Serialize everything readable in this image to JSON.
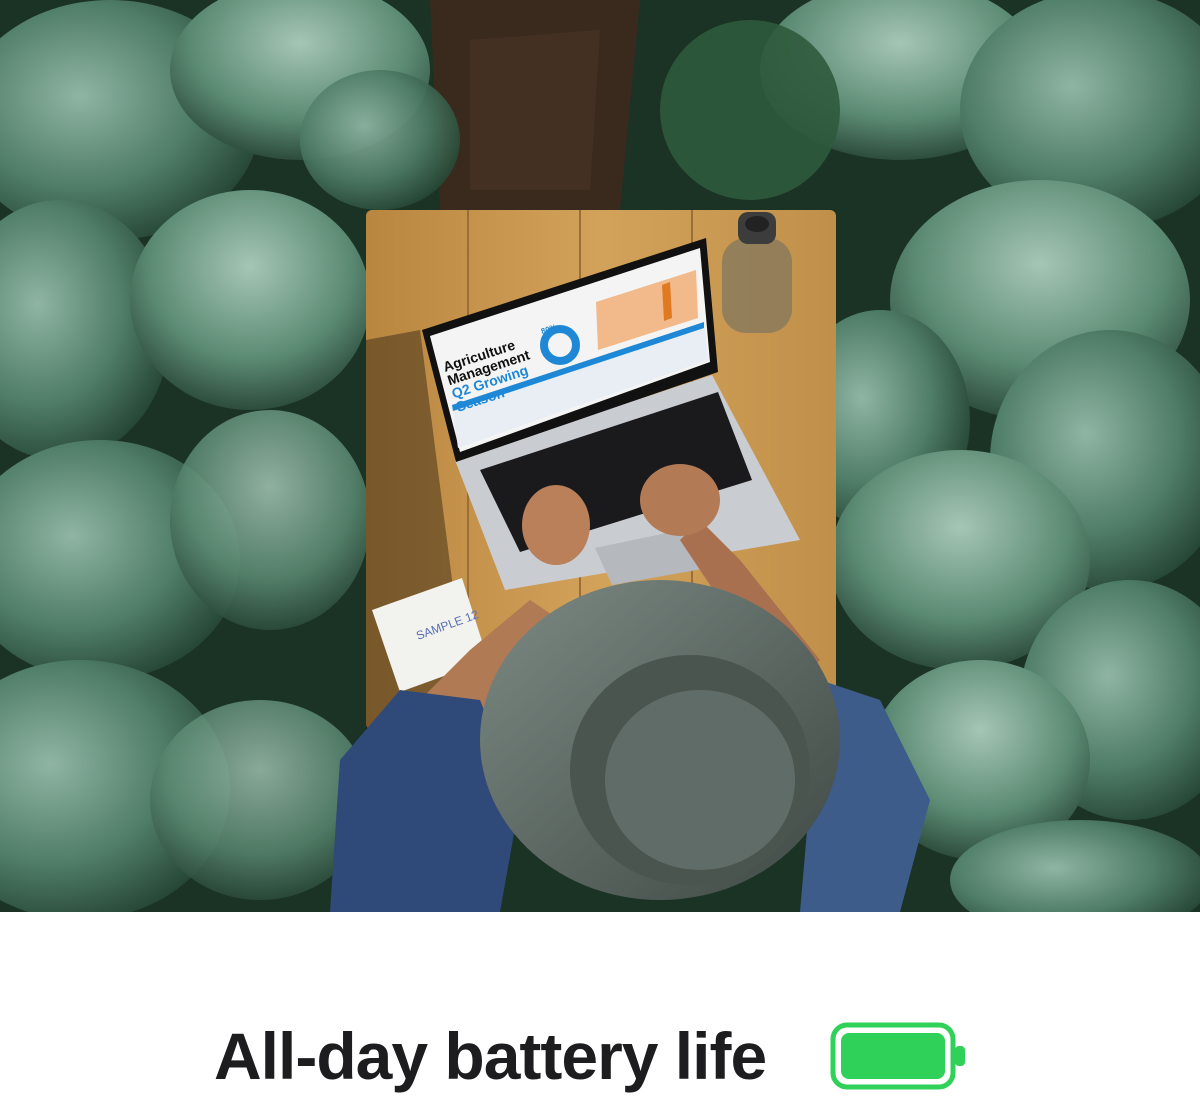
{
  "caption": {
    "text": "All-day battery life"
  },
  "battery": {
    "icon": "battery-full-icon",
    "level": 1.0,
    "fill_color": "#30d158",
    "frame_color": "#30d158"
  },
  "photo": {
    "description_icon": "photo",
    "laptop_screen": {
      "title_line1": "Agriculture",
      "title_line2": "Management",
      "subtitle_line1": "Q2 Growing",
      "subtitle_line2": "Season",
      "donut_value": "80%"
    },
    "notepad_text": "SAMPLE 12"
  },
  "colors": {
    "leaf_dark": "#1f3a28",
    "leaf_mid": "#3f6b55",
    "leaf_light": "#6d9a86",
    "table": "#c99a52",
    "soil": "#3a2a1e",
    "accent_blue": "#1e88d6",
    "accent_orange": "#f0a058"
  }
}
